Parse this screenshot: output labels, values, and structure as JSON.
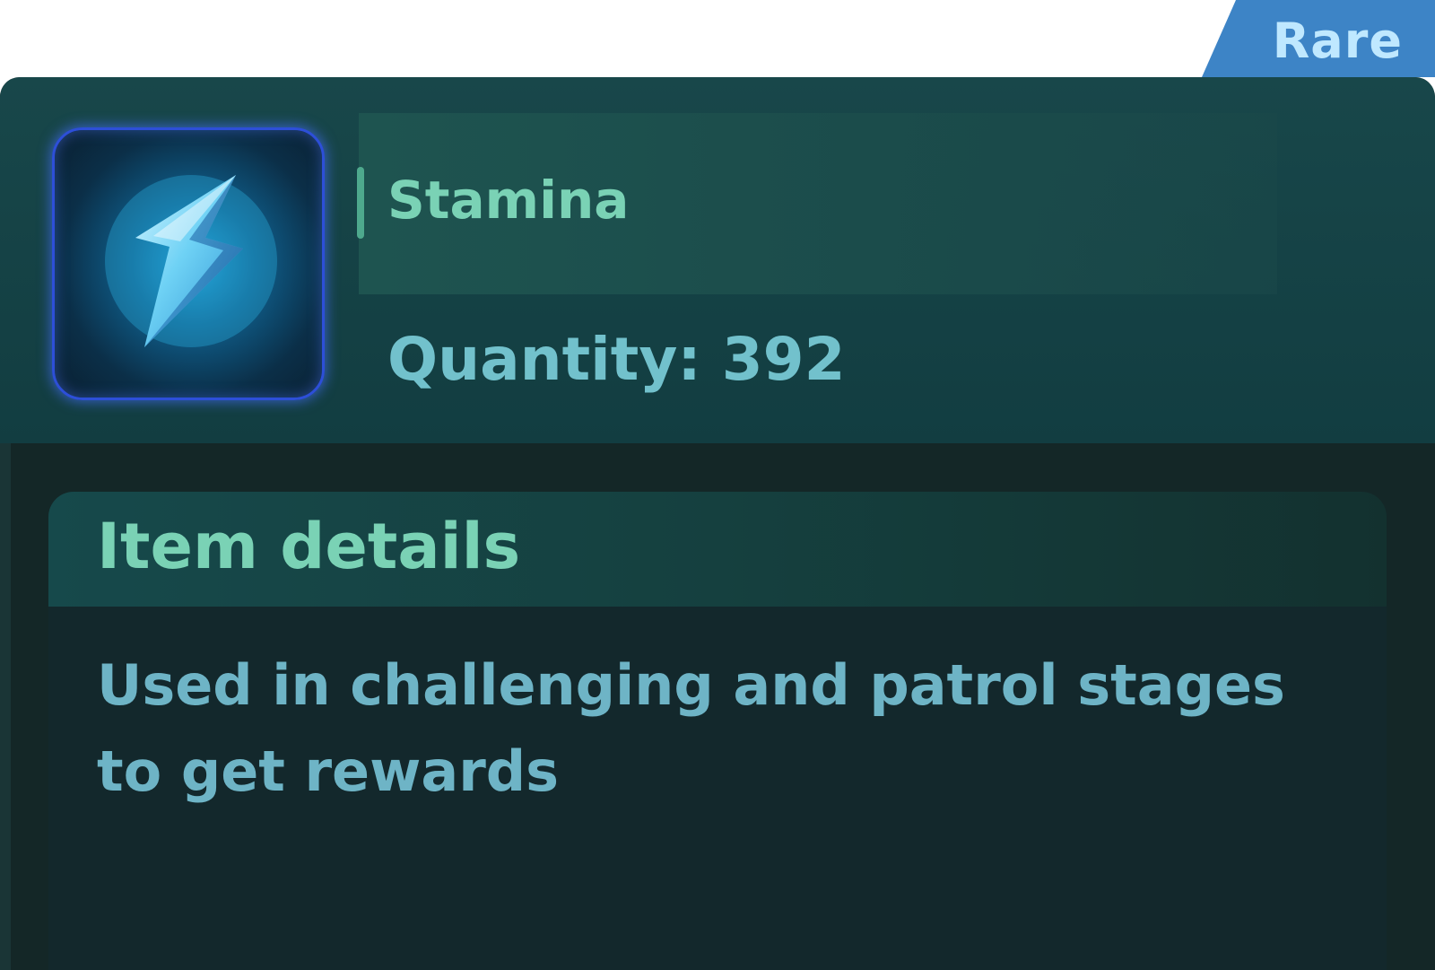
{
  "rarity": {
    "label": "Rare",
    "color": "#3d84c6"
  },
  "item": {
    "icon": "lightning-bolt-icon",
    "name": "Stamina",
    "quantity_label": "Quantity:",
    "quantity_value": "392"
  },
  "details": {
    "title": "Item details",
    "description": "Used in challenging and patrol stages to get rewards"
  },
  "colors": {
    "panel_background": "#142727",
    "header_background": "#18474a",
    "name_text": "#7ad2b5",
    "quantity_text": "#72c1cc",
    "description_text": "#6eb4c6",
    "icon_frame_border": "#2d4fd8"
  }
}
